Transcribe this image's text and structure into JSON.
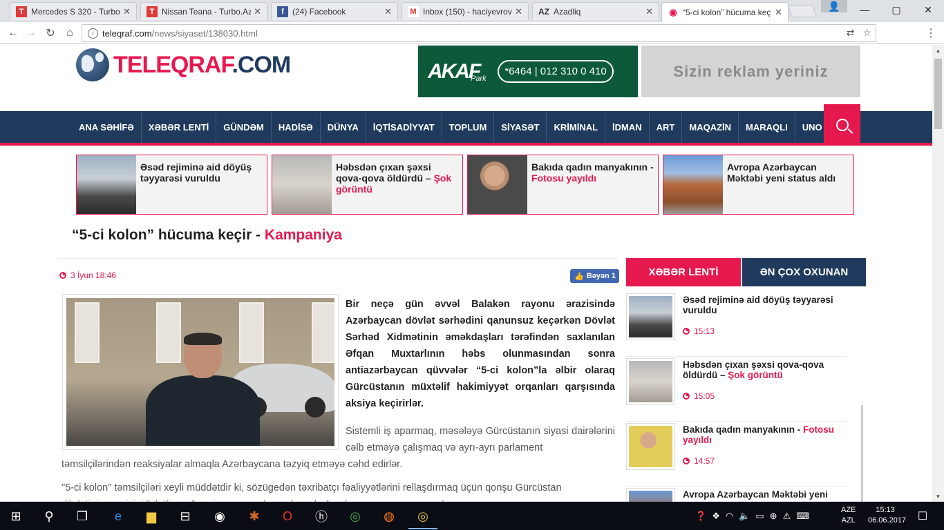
{
  "browser": {
    "tabs": [
      {
        "title": "Mercedes S 320 - Turbo.",
        "favicon": "T",
        "color": "#e03b3b"
      },
      {
        "title": "Nissan Teana - Turbo.Az",
        "favicon": "T",
        "color": "#e03b3b"
      },
      {
        "title": "(24) Facebook",
        "favicon": "f",
        "color": "#3b5998"
      },
      {
        "title": "Inbox (150) - haciyevrov",
        "favicon": "M",
        "color": "#d93025"
      },
      {
        "title": "Azadliq",
        "favicon": "AZ",
        "color": "#333333"
      },
      {
        "title": "“5-ci kolon” hücuma keç",
        "favicon": "◉",
        "color": "#e6194f"
      }
    ],
    "active_tab": 5,
    "url_host": "teleqraf.com",
    "url_path": "/news/siyaset/138030.html",
    "winctl": {
      "user": "👤",
      "minimize": "—",
      "maximize": "▢",
      "close": "✕"
    }
  },
  "site": {
    "logo_main": "TELEQRAF",
    "logo_dom": ".COM",
    "banner1": {
      "brand": "AKAF",
      "sub": "Park",
      "phone_short": "*6464",
      "phone": "012 310 0 410"
    },
    "banner2": "Sizin reklam yeriniz",
    "nav": [
      "ANA SƏHİFƏ",
      "XƏBƏR LENTİ",
      "GÜNDƏM",
      "HADİSƏ",
      "DÜNYA",
      "İQTİSADİYYAT",
      "TOPLUM",
      "SİYASƏT",
      "KRİMİNAL",
      "İDMAN",
      "ART",
      "MAQAZİN",
      "MARAQLI",
      "UNO"
    ]
  },
  "cards": [
    {
      "title": "Əsəd rejiminə aid döyüş təyyarəsi vuruldu",
      "highlight": ""
    },
    {
      "title": "Həbsdən çıxan şəxsi qova-qova öldürdü – ",
      "highlight": "Şok görüntü"
    },
    {
      "title": "Bakıda qadın manyakının - ",
      "highlight": "Fotosu yayıldı"
    },
    {
      "title": "Avropa Azərbaycan Məktəbi yeni status aldı",
      "highlight": ""
    }
  ],
  "article": {
    "title": "“5-ci kolon” hücuma keçir - ",
    "title_highlight": "Kampaniya",
    "date": "3 İyun 18:46",
    "like_label": "Bəyən 1",
    "lead": "Bir neçə gün əvvəl Balakən rayonu ərazisində Azərbaycan dövlət sərhədini qanunsuz keçərkən Dövlət Sərhəd Xidmətinin əməkdaşları tərəfindən saxlanılan Əfqan Muxtarlının həbs olunmasından sonra antiazərbaycan qüvvələr “5-ci kolon”la əlbir olaraq Gürcüstanın müxtəlif hakimiyyət orqanları qarşısında aksiya keçirirlər.",
    "p1a": "Sistemli iş aparmaq, məsələyə Gürcüstanın siyasi dairələrini cəlb etməyə çalışmaq və ayrı-ayrı parlament",
    "p1b": "təmsilçilərindən reaksiyalar almaqla Azərbaycana təzyiq etməyə cəhd edirlər.",
    "p2": "\"5-ci kolon\" təmsilçiləri xeyli müddətdir ki, sözügedən təxribatçı fəaliyyətlərini rellaşdırmaq üçün qonşu Gürcüstan",
    "p3": "dövlətinin ərazisini \"platforma\" seçir, ora qaçırlar və burada Azərbaycana qarşı çoxsaylı..."
  },
  "sidebar": {
    "tab_news": "XƏBƏR LENTİ",
    "tab_popular": "ƏN ÇOX OXUNAN",
    "items": [
      {
        "title": "Əsəd rejiminə aid döyüş təyyarəsi vuruldu",
        "highlight": "",
        "time": "15:13"
      },
      {
        "title": "Həbsdən çıxan şəxsi qova-qova öldürdü – ",
        "highlight": "Şok görüntü",
        "time": "15:05"
      },
      {
        "title": "Bakıda qadın manyakının - ",
        "highlight": "Fotosu yayıldı",
        "time": "14:57"
      },
      {
        "title": "Avropa Azərbaycan Məktəbi yeni",
        "highlight": "",
        "time": ""
      }
    ]
  },
  "taskbar": {
    "lang1": "AZE",
    "lang2": "AZL",
    "time": "15:13",
    "date": "06.06.2017"
  }
}
